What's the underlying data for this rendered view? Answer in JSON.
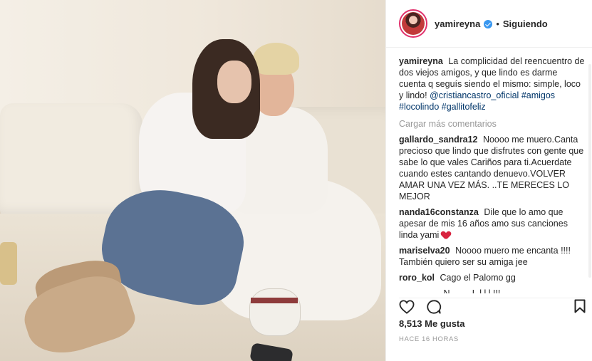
{
  "post": {
    "image_alt": "Foto de yamireyna",
    "header": {
      "username": "yamireyna",
      "dot": "•",
      "follow_status": "Siguiendo"
    },
    "caption": {
      "username": "yamireyna",
      "text": "La complicidad del reencuentro de dos viejos amigos, y que lindo es darme cuenta q seguís siendo el mismo: simple, loco y lindo!",
      "mention": "@cristiancastro_oficial",
      "hashtags": [
        "#amigos",
        "#locolindo",
        "#gallitofeliz"
      ]
    },
    "load_more": "Cargar más comentarios",
    "comments": [
      {
        "username": "gallardo_sandra12",
        "text": "Noooo me muero.Canta precioso que lindo que disfrutes con gente que sabe lo que vales Cariños para ti.Acuerdate cuando estes cantando denuevo.VOLVER AMAR UNA VEZ MÁS. ..TE MERECES LO MEJOR"
      },
      {
        "username": "nanda16constanza",
        "text": "Dile que lo amo que apesar de mis 16 años amo sus canciones linda yami"
      },
      {
        "username": "mariselva20",
        "text": "Noooo muero me encanta !!!! También quiero ser su amiga jee"
      },
      {
        "username": "roro_kol",
        "text": "Cago el Palomo gg"
      }
    ],
    "cut_comment": "................. N........ L.l.l.l.!!!",
    "likes": "8,513 Me gusta",
    "time": "HACE 16 HORAS",
    "colors": {
      "link": "#003569",
      "verified": "#3897f0",
      "muted": "#999999"
    }
  }
}
